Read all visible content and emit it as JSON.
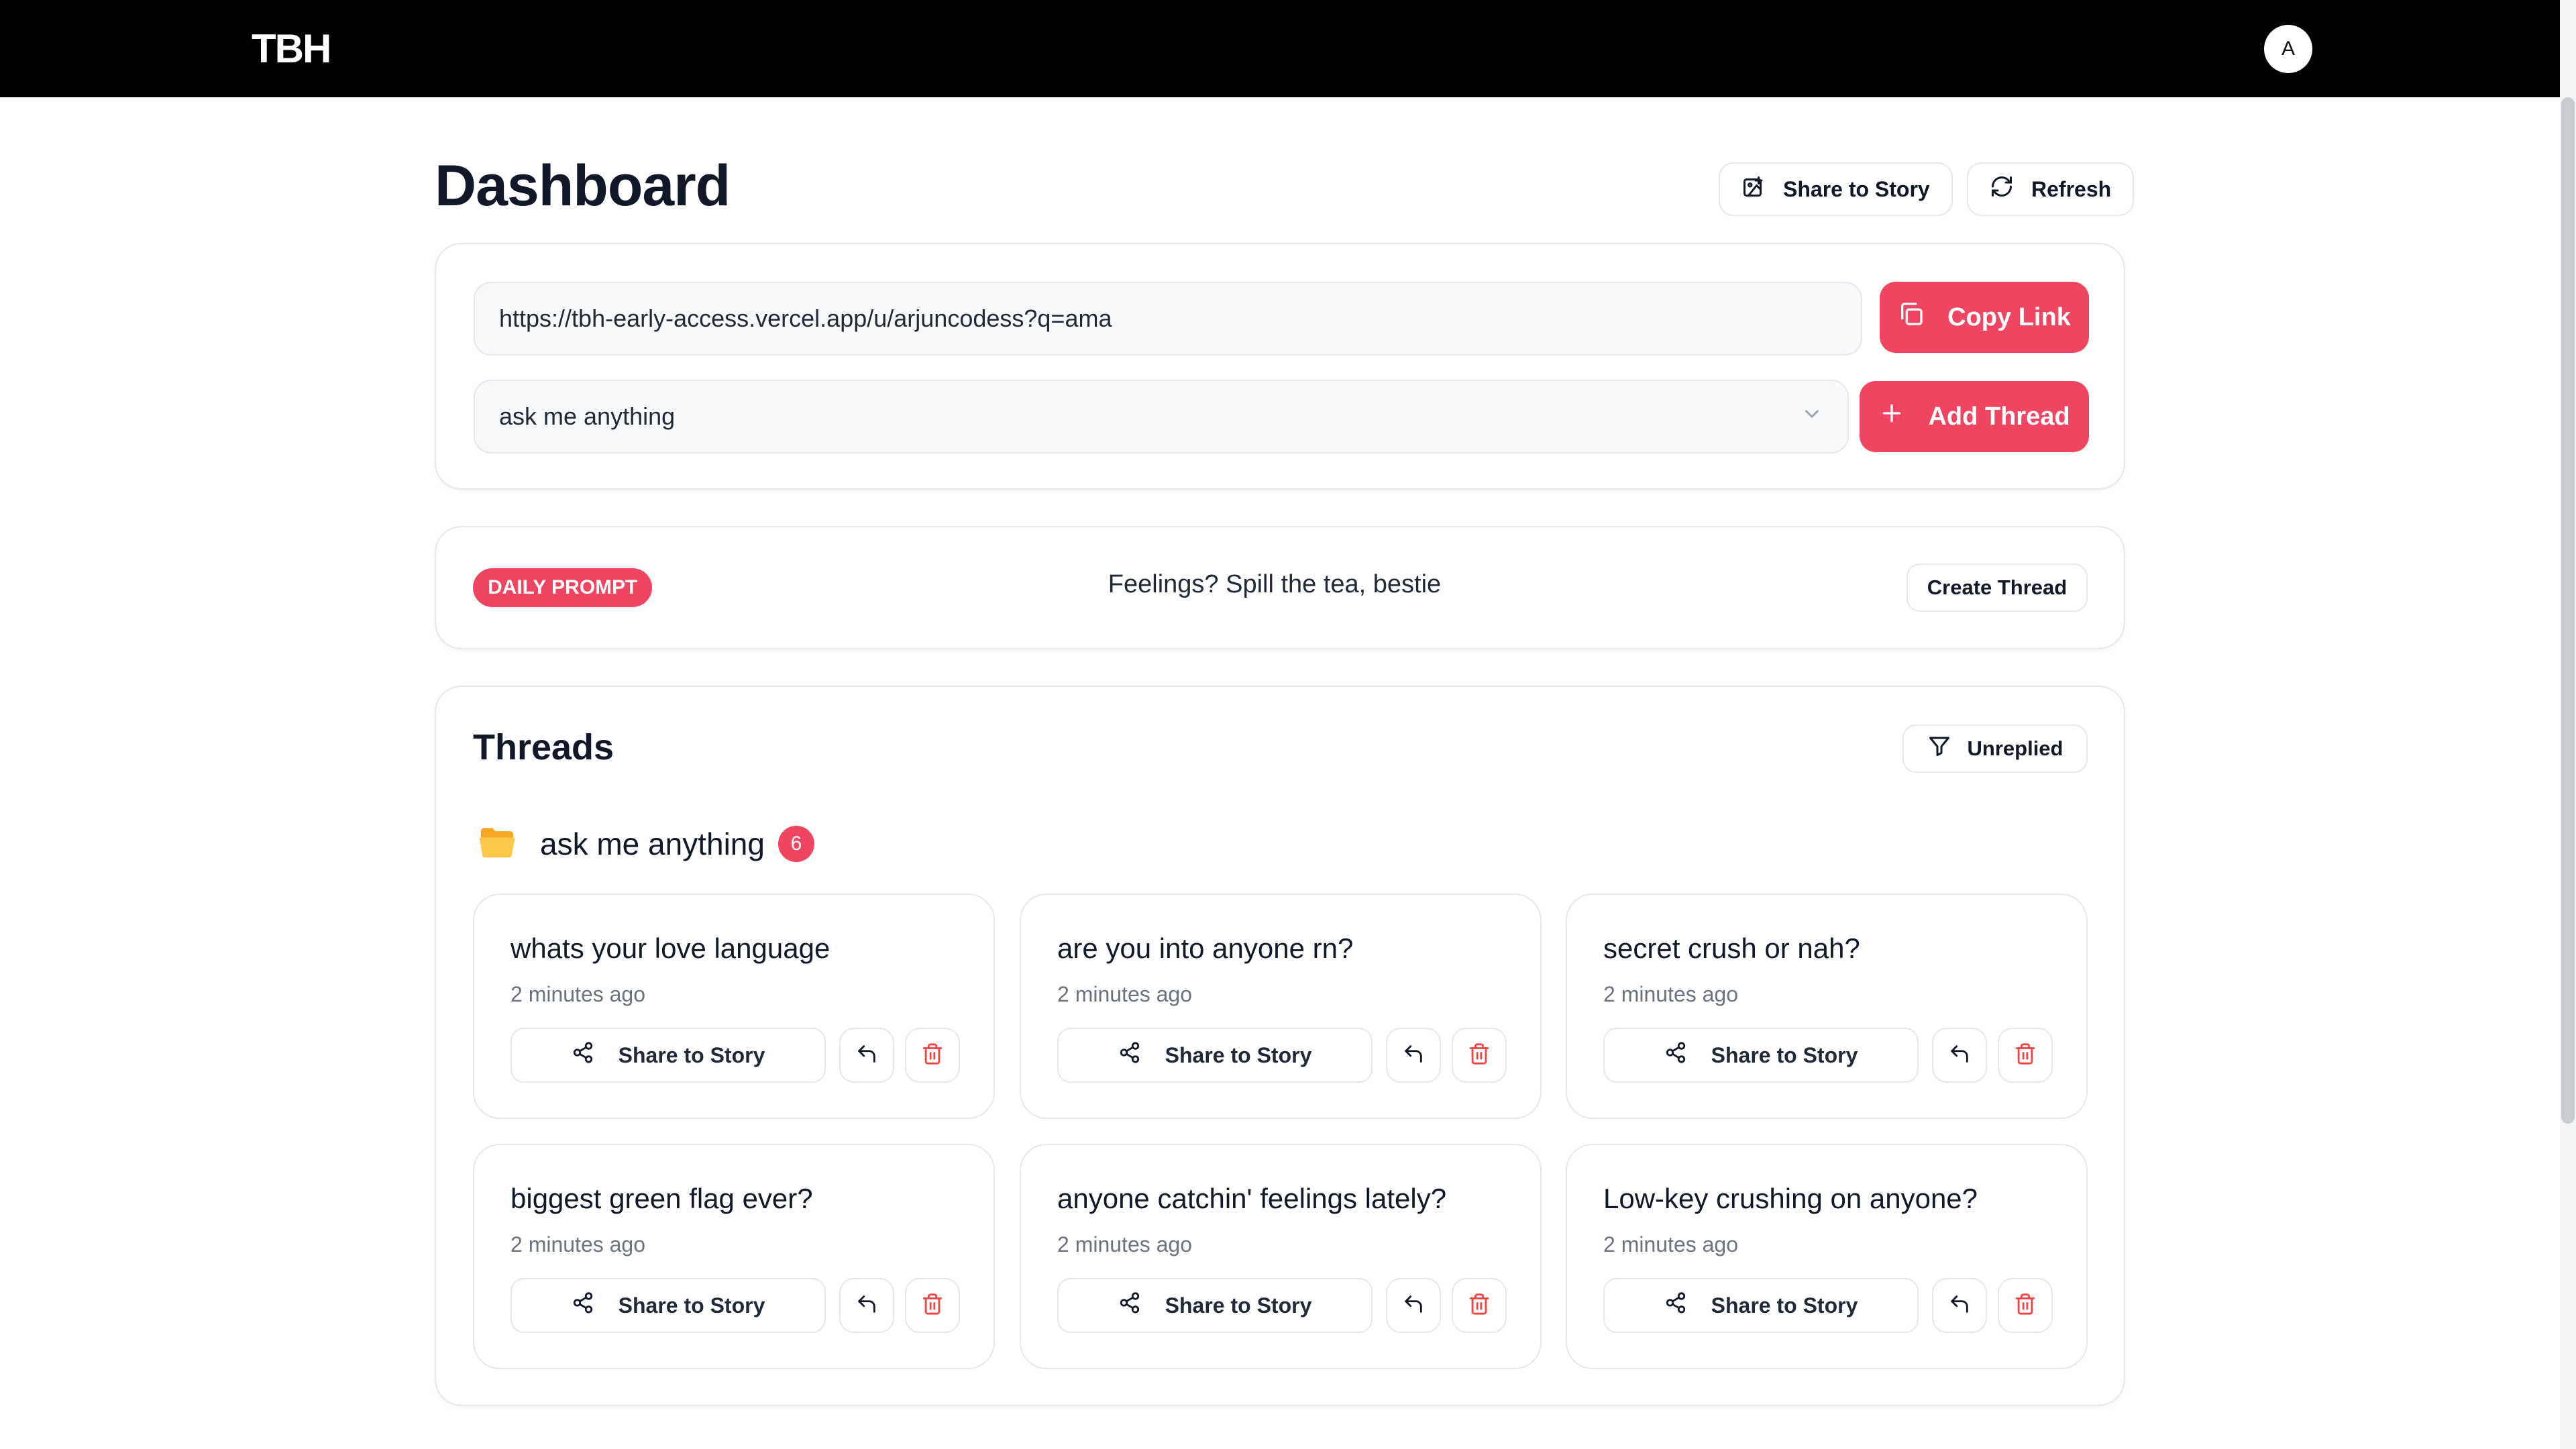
{
  "app": {
    "logo": "TBH",
    "avatar_initial": "A"
  },
  "header": {
    "title": "Dashboard",
    "share_label": "Share to Story",
    "refresh_label": "Refresh"
  },
  "link_card": {
    "url": "https://tbh-early-access.vercel.app/u/arjuncodess?q=ama",
    "copy_label": "Copy Link",
    "select_value": "ask me anything",
    "add_label": "Add Thread"
  },
  "daily_prompt": {
    "badge": "DAILY PROMPT",
    "text": "Feelings? Spill the tea, bestie",
    "create_label": "Create Thread"
  },
  "threads": {
    "title": "Threads",
    "filter_label": "Unreplied",
    "group": {
      "name": "ask me anything",
      "count": "6",
      "icon": "folder-icon"
    },
    "items": [
      {
        "question": "whats your love language",
        "time": "2 minutes ago",
        "share_label": "Share to Story"
      },
      {
        "question": "are you into anyone rn?",
        "time": "2 minutes ago",
        "share_label": "Share to Story"
      },
      {
        "question": "secret crush or nah?",
        "time": "2 minutes ago",
        "share_label": "Share to Story"
      },
      {
        "question": "biggest green flag ever?",
        "time": "2 minutes ago",
        "share_label": "Share to Story"
      },
      {
        "question": "anyone catchin' feelings lately?",
        "time": "2 minutes ago",
        "share_label": "Share to Story"
      },
      {
        "question": "Low-key crushing on anyone?",
        "time": "2 minutes ago",
        "share_label": "Share to Story"
      }
    ]
  },
  "colors": {
    "accent": "#ef4560",
    "topbar": "#000000",
    "border": "#e5e7eb"
  }
}
